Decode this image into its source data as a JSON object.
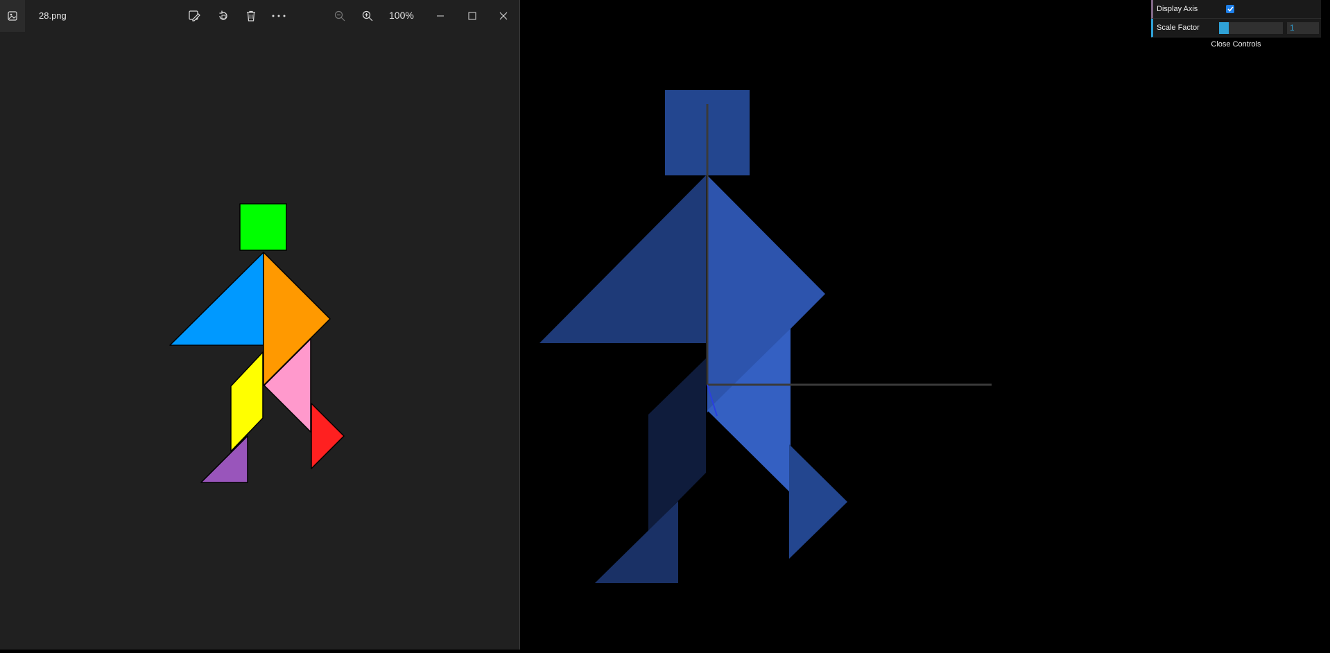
{
  "viewer": {
    "filename": "28.png",
    "zoom": "100%",
    "toolbar": {
      "edit_icon": "edit-image-icon",
      "rotate_icon": "rotate-icon",
      "delete_icon": "delete-icon",
      "more_icon": "more-icon",
      "zoom_out_icon": "zoom-out-icon",
      "zoom_in_icon": "zoom-in-icon"
    },
    "window_controls": [
      "minimize-icon",
      "maximize-icon",
      "close-icon"
    ],
    "tangram_colors": {
      "head": "#00ff00",
      "left_large": "#0099ff",
      "right_large": "#ff9900",
      "parallelogram": "#ffff00",
      "pink": "#ff99cc",
      "red": "#ff2020",
      "purple": "#9955bb"
    }
  },
  "scene": {
    "background": "#000000",
    "piece_color": "#2b4f9e"
  },
  "controls": {
    "display_axis_label": "Display Axis",
    "display_axis": true,
    "scale_factor_label": "Scale Factor",
    "scale_factor": "1",
    "scale_factor_fraction": 0.05,
    "close_label": "Close Controls"
  }
}
